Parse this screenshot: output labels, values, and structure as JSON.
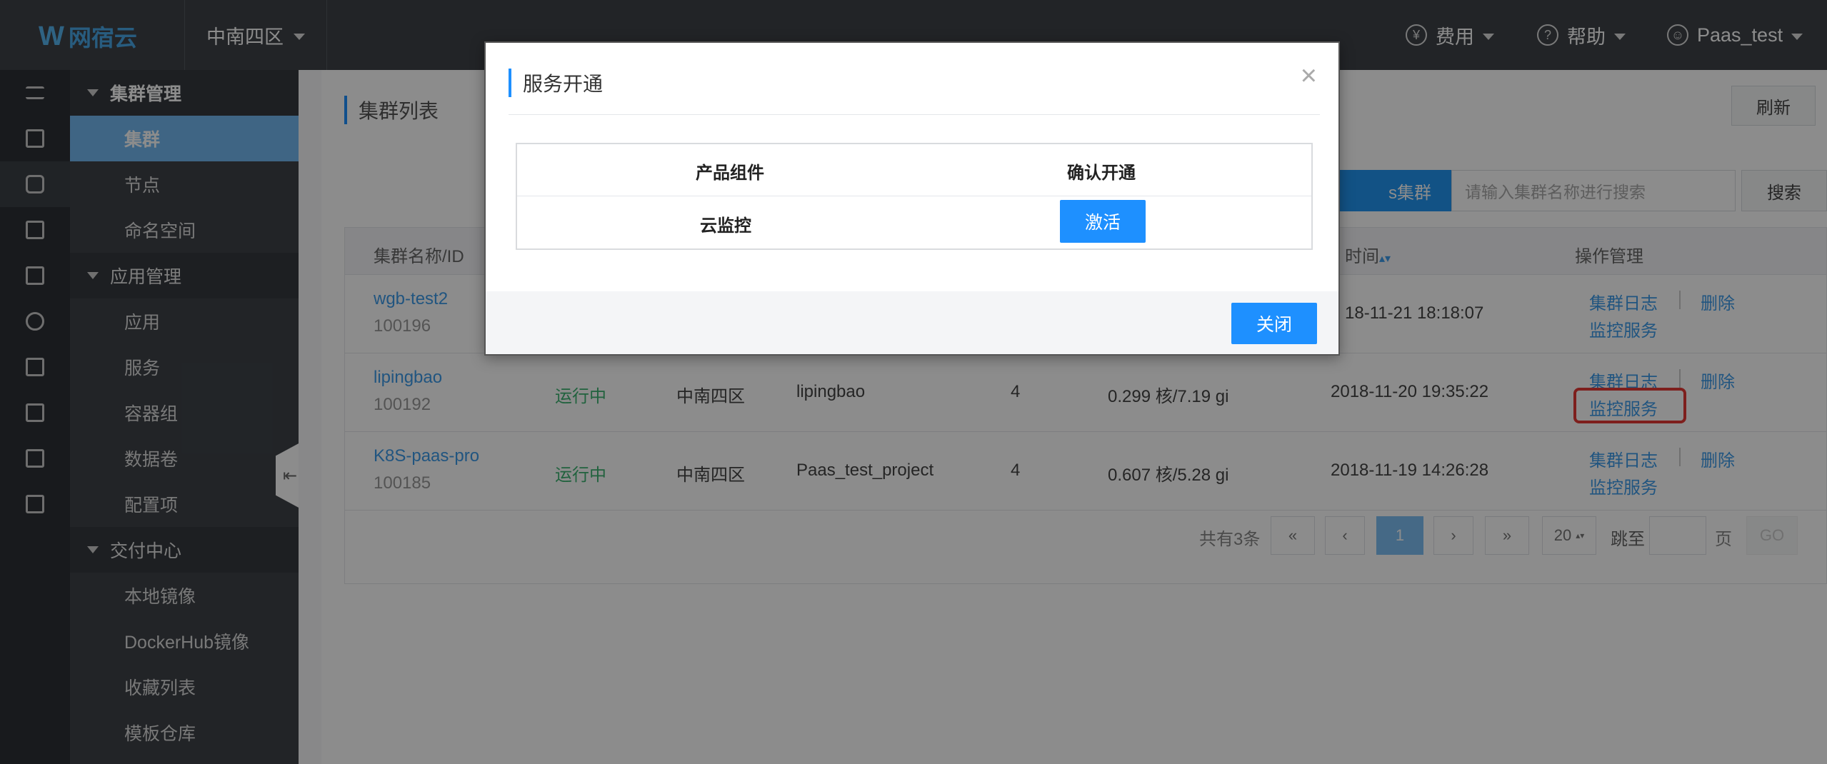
{
  "header": {
    "logo_text": "网宿云",
    "region": "中南四区",
    "fee": "费用",
    "help": "帮助",
    "user": "Paas_test",
    "fee_icon": "¥",
    "help_icon": "?"
  },
  "sidebar": {
    "groups": [
      {
        "label": "集群管理",
        "items": [
          "集群",
          "节点",
          "命名空间"
        ]
      },
      {
        "label": "应用管理",
        "items": [
          "应用",
          "服务",
          "容器组",
          "数据卷",
          "配置项"
        ]
      },
      {
        "label": "交付中心",
        "items": [
          "本地镜像",
          "DockerHub镜像",
          "收藏列表",
          "模板仓库"
        ]
      }
    ],
    "active_item": "集群"
  },
  "page": {
    "title": "集群列表",
    "refresh": "刷新",
    "add_cluster": "s集群",
    "search_placeholder": "请输入集群名称进行搜索",
    "search_button": "搜索"
  },
  "table": {
    "headers": [
      "集群名称/ID",
      "时间",
      "操作管理"
    ],
    "rows": [
      {
        "name": "wgb-test2",
        "id": "100196",
        "status": "",
        "region": "",
        "project": "",
        "nodes": "",
        "resource": "",
        "time": "18-11-21 18:18:07",
        "action_log": "集群日志",
        "action_delete": "删除",
        "action_monitor": "监控服务"
      },
      {
        "name": "lipingbao",
        "id": "100192",
        "status": "运行中",
        "region": "中南四区",
        "project": "lipingbao",
        "nodes": "4",
        "resource": "0.299 核/7.19 gi",
        "time": "2018-11-20 19:35:22",
        "action_log": "集群日志",
        "action_delete": "删除",
        "action_monitor": "监控服务"
      },
      {
        "name": "K8S-paas-pro",
        "id": "100185",
        "status": "运行中",
        "region": "中南四区",
        "project": "Paas_test_project",
        "nodes": "4",
        "resource": "0.607 核/5.28 gi",
        "time": "2018-11-19 14:26:28",
        "action_log": "集群日志",
        "action_delete": "删除",
        "action_monitor": "监控服务"
      }
    ]
  },
  "pagination": {
    "total": "共有3条",
    "first": "«",
    "prev": "‹",
    "current": "1",
    "next": "›",
    "last": "»",
    "page_size": "20",
    "jump_label": "跳至",
    "page_unit": "页",
    "go": "GO"
  },
  "modal": {
    "title": "服务开通",
    "close_x": "×",
    "col_component": "产品组件",
    "col_confirm": "确认开通",
    "component": "云监控",
    "activate": "激活",
    "close": "关闭"
  },
  "colors": {
    "accent": "#1e90ff",
    "sidebar_active": "#73b9f0",
    "highlight": "#e53935"
  }
}
